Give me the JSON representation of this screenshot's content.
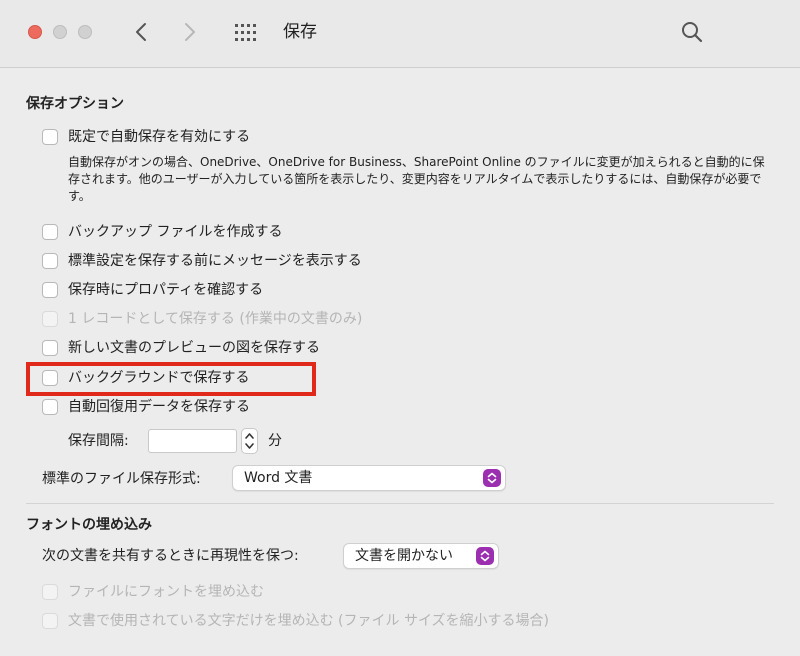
{
  "window": {
    "title": "保存"
  },
  "icons": {
    "back": "chevron-left-icon",
    "forward": "chevron-right-icon",
    "grid": "grid-icon",
    "search": "search-icon",
    "popup_arrow": "up-down-chevron-icon"
  },
  "colors": {
    "accent": "#9b2fb0",
    "highlight": "#e0291b"
  },
  "save_options": {
    "title": "保存オプション",
    "autosave_label": "既定で自動保存を有効にする",
    "autosave_description": "自動保存がオンの場合、OneDrive、OneDrive for Business、SharePoint Online のファイルに変更が加えられると自動的に保存されます。他のユーザーが入力している箇所を表示したり、変更内容をリアルタイムで表示したりするには、自動保存が必要です。",
    "backup_label": "バックアップ ファイルを作成する",
    "prompt_normal_label": "標準設定を保存する前にメッセージを表示する",
    "properties_label": "保存時にプロパティを確認する",
    "single_record_label": "1 レコードとして保存する (作業中の文書のみ)",
    "preview_label": "新しい文書のプレビューの図を保存する",
    "background_label": "バックグラウンドで保存する",
    "autorecover_label": "自動回復用データを保存する",
    "interval_label": "保存間隔:",
    "interval_value": "",
    "interval_unit": "分",
    "format_label": "標準のファイル保存形式:",
    "format_value": "Word 文書"
  },
  "font_embedding": {
    "title": "フォントの埋め込み",
    "fidelity_label": "次の文書を共有するときに再現性を保つ:",
    "fidelity_value": "文書を開かない",
    "embed_fonts_label": "ファイルにフォントを埋め込む",
    "embed_used_chars_label": "文書で使用されている文字だけを埋め込む (ファイル サイズを縮小する場合)"
  }
}
